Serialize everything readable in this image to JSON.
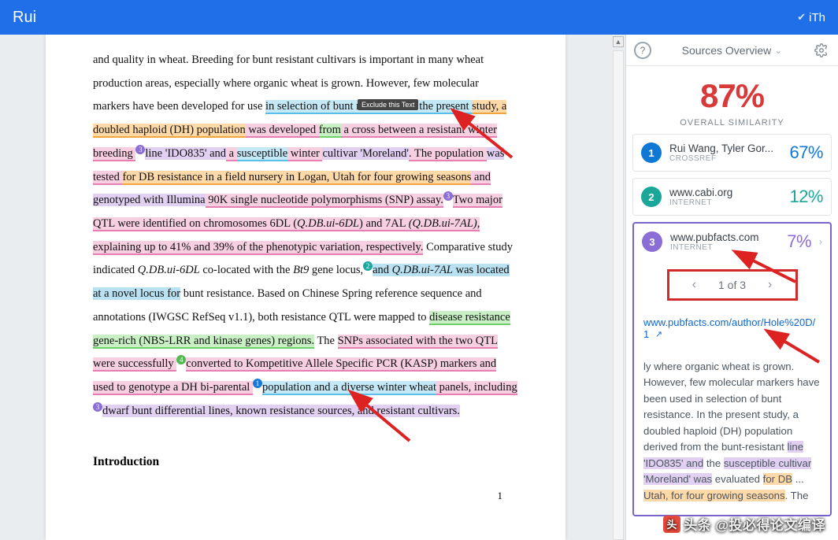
{
  "topbar": {
    "title": "Rui",
    "brand": "iTh",
    "check": "✔"
  },
  "tooltip": "Exclude this Text",
  "paper": {
    "page_number": "1",
    "section_heading": "Introduction",
    "segments": [
      {
        "t": "and quality in wheat. Breeding for bunt resistant cultivars is important in many wheat production areas, especially where organic wheat is grown. However, few molecular markers have been developed for use "
      },
      {
        "t": "in selection of bunt resistance. In the present ",
        "cls": "hl-blue"
      },
      {
        "t": "study, a doubled haploid (DH) population",
        "cls": "hl-orange"
      },
      {
        "t": " was developed ",
        "cls": "hl-pink"
      },
      {
        "t": "from",
        "cls": "hl-green"
      },
      {
        "t": " a cross between a resistant winter breeding ",
        "cls": "hl-pink"
      },
      {
        "badge": "3",
        "bcls": "b3"
      },
      {
        "t": "line 'IDO835' and",
        "cls": "hl-purple"
      },
      {
        "t": " a ",
        "cls": "hl-pink"
      },
      {
        "t": "susceptible",
        "cls": "hl-blue"
      },
      {
        "t": " winter ",
        "cls": "hl-pink"
      },
      {
        "t": "cultivar 'Moreland'",
        "cls": "hl-purple"
      },
      {
        "t": ". The population ",
        "cls": "hl-pink"
      },
      {
        "t": "was",
        "cls": "hl-purple"
      },
      {
        "t": " tested ",
        "cls": "hl-pink"
      },
      {
        "t": "for DB resistance in a field nursery in Logan, Utah for four growing seasons",
        "cls": "hl-orange"
      },
      {
        "t": " and ",
        "cls": "hl-pink"
      },
      {
        "t": "genotyped with Illumina",
        "cls": "hl-purple"
      },
      {
        "t": " 90K single nucleotide polymorphisms (SNP) assay.",
        "cls": "hl-pink"
      },
      {
        "badge": "3",
        "bcls": "b3"
      },
      {
        "t": "Two major QTL were identified on chromosomes 6DL (",
        "cls": "hl-pink"
      },
      {
        "t": "Q.DB.ui-6DL",
        "cls": "hl-pink ital"
      },
      {
        "t": ") and 7AL ",
        "cls": "hl-pink"
      },
      {
        "t": "(Q.DB.ui-7AL)",
        "cls": "hl-pink ital"
      },
      {
        "t": ", explaining up to 41% and 39% of the phenotypic variation, respectively.",
        "cls": "hl-pink"
      },
      {
        "t": " Comparative study indicated "
      },
      {
        "t": "Q.DB.ui-6DL",
        "cls": "ital"
      },
      {
        "t": " co-located with the "
      },
      {
        "t": "Bt9",
        "cls": "ital"
      },
      {
        "t": " gene locus,"
      },
      {
        "badge": "2",
        "bcls": "b2"
      },
      {
        "t": "and ",
        "cls": "hl-bluebox"
      },
      {
        "t": "Q.DB.ui-7AL",
        "cls": "hl-bluebox ital"
      },
      {
        "t": " was located at a novel locus for",
        "cls": "hl-bluebox"
      },
      {
        "t": " bunt resistance. Based on Chinese Spring reference sequence and annotations (IWGSC RefSeq v1.1), both resistance QTL were mapped to "
      },
      {
        "t": "disease resistance gene-rich (NBS-LRR and kinase genes) regions.",
        "cls": "hl-green"
      },
      {
        "t": " The "
      },
      {
        "t": "SNPs associated with the two QTL were successfully ",
        "cls": "hl-pink"
      },
      {
        "badge": "4",
        "bcls": "b4"
      },
      {
        "t": "converted to Kompetitive Allele Specific PCR (KASP) markers and used to genotype a DH bi-parental ",
        "cls": "hl-pink"
      },
      {
        "badge": "1",
        "bcls": "b1"
      },
      {
        "t": "population and a diverse winter wheat",
        "cls": "hl-blue"
      },
      {
        "t": " panels, including ",
        "cls": "hl-pink"
      },
      {
        "badge": "3",
        "bcls": "b3"
      },
      {
        "t": "dwarf bunt differential lines, known resistance sources, and resistant cultivars.",
        "cls": "hl-purple"
      }
    ]
  },
  "panel": {
    "title": "Sources Overview",
    "help": "?",
    "overall_pct": "87%",
    "overall_label": "OVERALL SIMILARITY",
    "sources": [
      {
        "n": "1",
        "title": "Rui Wang, Tyler Gor...",
        "sub": "CROSSREF",
        "pct": "67%"
      },
      {
        "n": "2",
        "title": "www.cabi.org",
        "sub": "INTERNET",
        "pct": "12%"
      },
      {
        "n": "3",
        "title": "www.pubfacts.com",
        "sub": "INTERNET",
        "pct": "7%"
      }
    ],
    "pager": {
      "pos": "1 of 3"
    },
    "link_text": "www.pubfacts.com/author/Hole%20D/1",
    "ext_icon": "↗",
    "match_segments": [
      {
        "t": "ly where organic wheat is grown. However, few molecular markers have been used in selection of bunt resistance. In the present study, a doubled haploid (DH) population derived from the bunt-resistant "
      },
      {
        "t": "line 'IDO835' and",
        "cls": "mp"
      },
      {
        "t": " the "
      },
      {
        "t": "susceptible cultivar 'Moreland' was",
        "cls": "mp"
      },
      {
        "t": " evaluated "
      },
      {
        "t": "for DB",
        "cls": "mo"
      },
      {
        "t": " ... "
      },
      {
        "t": "Utah, for four growing seasons",
        "cls": "mo"
      },
      {
        "t": ". The"
      }
    ]
  },
  "watermark": "头条 @投必得论文编译"
}
